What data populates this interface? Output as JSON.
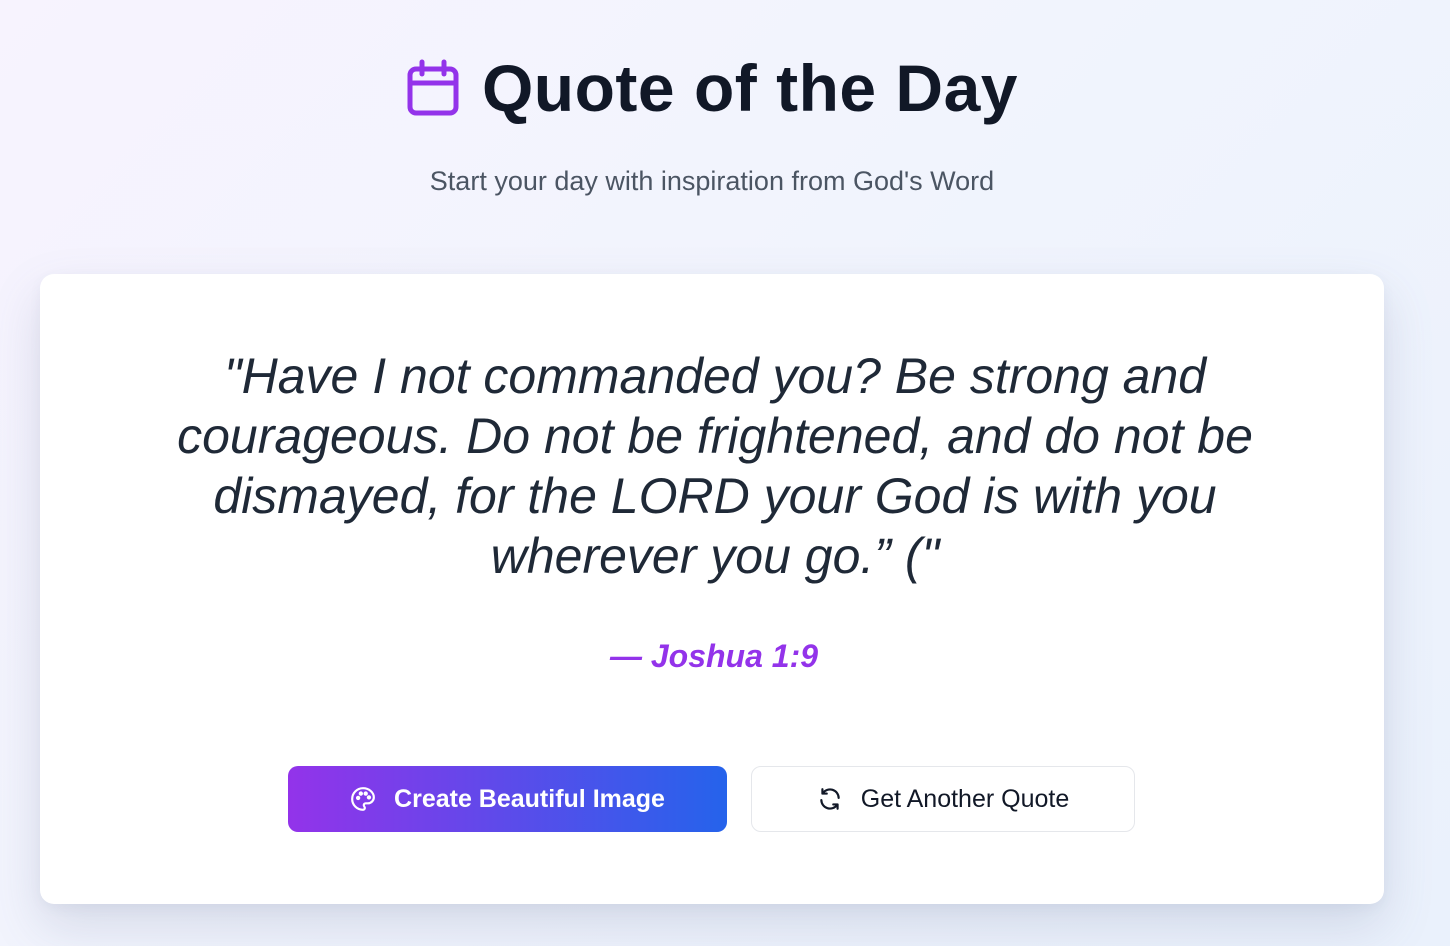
{
  "header": {
    "title": "Quote of the Day",
    "subtitle": "Start your day with inspiration from God's Word",
    "icon": "calendar-icon"
  },
  "quote": {
    "text": "\"Have I not commanded you? Be strong and courageous. Do not be frightened, and do not be dismayed, for the LORD your God is with you wherever you go.” (\"",
    "reference": "— Joshua 1:9"
  },
  "actions": {
    "create_image": {
      "label": "Create Beautiful Image",
      "icon": "palette-icon"
    },
    "another_quote": {
      "label": "Get Another Quote",
      "icon": "refresh-icon"
    }
  },
  "colors": {
    "accent_purple": "#9333ea",
    "accent_blue": "#2563eb",
    "title": "#111827"
  }
}
